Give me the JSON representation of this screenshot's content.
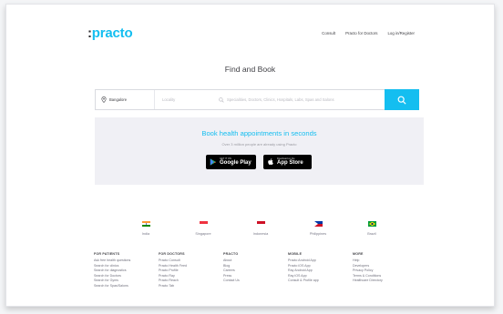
{
  "header": {
    "logo": "practo",
    "nav": [
      "Consult",
      "Practo for Doctors",
      "Log in/Register"
    ]
  },
  "hero": {
    "title": "Find and Book"
  },
  "search": {
    "location": "Bangalore",
    "locality_placeholder": "Locality",
    "query_placeholder": "Specialities, Doctors, Clinics, Hospitals, Labs, Spas and Salons"
  },
  "banner": {
    "title": "Book health appointments in seconds",
    "subtitle": "Over 3 million people are already using Practo",
    "google_play": {
      "small": "GET IT ON",
      "big": "Google Play"
    },
    "app_store": {
      "small": "Download on the",
      "big": "App Store"
    }
  },
  "countries": [
    {
      "name": "India",
      "flag": "india"
    },
    {
      "name": "Singapore",
      "flag": "singapore"
    },
    {
      "name": "Indonesia",
      "flag": "indonesia"
    },
    {
      "name": "Philippines",
      "flag": "philippines"
    },
    {
      "name": "Brazil",
      "flag": "brazil"
    }
  ],
  "footer": [
    {
      "head": "FOR PATIENTS",
      "links": [
        "Ask free health questions",
        "Search for clinics",
        "Search for diagnostics",
        "Search for Doctors",
        "Search for Gyms",
        "Search for Spas/Salons"
      ]
    },
    {
      "head": "FOR DOCTORS",
      "links": [
        "Practo Consult",
        "Practo Health Feed",
        "Practo Profile",
        "Practo Ray",
        "Practo Reach",
        "Practo Tab"
      ]
    },
    {
      "head": "PRACTO",
      "links": [
        "About",
        "Blog",
        "Careers",
        "Press",
        "Contact Us"
      ]
    },
    {
      "head": "MOBILE",
      "links": [
        "Practo Android App",
        "Practo iOS App",
        "Ray Android App",
        "Ray iOS App",
        "Consult & Profile app"
      ]
    },
    {
      "head": "MORE",
      "links": [
        "Help",
        "Developers",
        "Privacy Policy",
        "Terms & Conditions",
        "Healthcare Directory"
      ]
    }
  ],
  "colors": {
    "brand": "#14bef0",
    "text": "#414146",
    "banner_bg": "#f0f0f5"
  }
}
